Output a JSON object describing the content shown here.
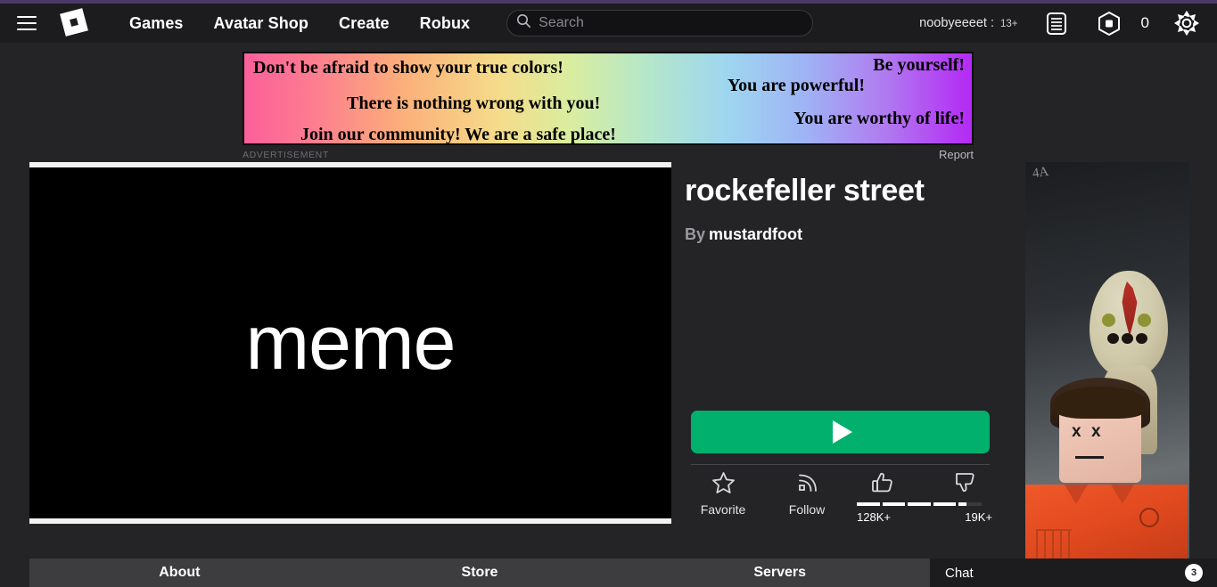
{
  "header": {
    "menu_icon": "hamburger-menu-icon",
    "logo_icon": "roblox-logo-icon",
    "nav": [
      {
        "label": "Games"
      },
      {
        "label": "Avatar Shop"
      },
      {
        "label": "Create"
      },
      {
        "label": "Robux"
      }
    ],
    "search": {
      "icon": "search-icon",
      "placeholder": "Search",
      "value": ""
    },
    "account": {
      "username": "noobyeeeet :",
      "age_badge": "13+"
    },
    "icons": {
      "list": "list-menu-icon",
      "robux": "robux-hexagon-icon",
      "settings": "gear-icon"
    },
    "robux_count": "0",
    "accent_color": "#4b3768",
    "background_color": "#1c1c1e"
  },
  "advertisement": {
    "label": "ADVERTISEMENT",
    "report_label": "Report",
    "lines": [
      "Don't be afraid to show your true colors!",
      "Be yourself!",
      "There is nothing wrong with you!",
      "You are powerful!",
      "Join our community! We are a safe place!",
      "You are worthy of life!"
    ]
  },
  "thumbnail": {
    "text": "meme",
    "background_color": "#000000"
  },
  "game": {
    "title": "rockefeller street",
    "by_label": "By",
    "author": "mustardfoot"
  },
  "play": {
    "icon": "play-triangle-icon",
    "color": "#01b06d"
  },
  "actions": [
    {
      "name": "favorite",
      "icon": "star-icon",
      "label": "Favorite"
    },
    {
      "name": "follow",
      "icon": "rss-signal-icon",
      "label": "Follow"
    }
  ],
  "votes": {
    "up": {
      "icon": "thumbs-up-icon",
      "count": "128K+"
    },
    "down": {
      "icon": "thumbs-down-icon",
      "count": "19K+"
    },
    "rating_segments": [
      1,
      1,
      1,
      1,
      0.35
    ]
  },
  "character_art": {
    "scribble": "4A",
    "alt": "SCP-173 and Roblox avatar in orange jumpsuit"
  },
  "tabs": [
    {
      "label": "About"
    },
    {
      "label": "Store"
    },
    {
      "label": "Servers"
    }
  ],
  "chat": {
    "label": "Chat",
    "badge": "3"
  }
}
